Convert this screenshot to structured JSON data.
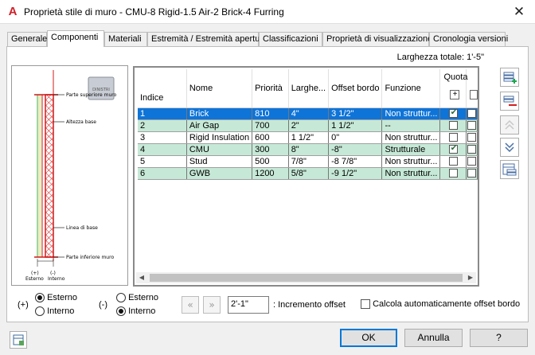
{
  "window": {
    "app_icon": "A",
    "title": "Proprietà stile di muro - CMU-8 Rigid-1.5 Air-2 Brick-4 Furring",
    "close_icon": "close-icon"
  },
  "tabs": [
    {
      "label": "Generale"
    },
    {
      "label": "Componenti"
    },
    {
      "label": "Materiali"
    },
    {
      "label": "Estremità / Estremità apertura"
    },
    {
      "label": "Classificazioni"
    },
    {
      "label": "Proprietà di visualizzazione"
    },
    {
      "label": "Cronologia versioni"
    }
  ],
  "total_width": "Larghezza totale: 1'-5\"",
  "preview": {
    "labels": {
      "top": "Parte superiore muro",
      "height": "Altezza base",
      "baseline": "Linea di base",
      "bottom": "Parte inferiore muro",
      "ext_sign": "(+)",
      "ext": "Esterno",
      "int_sign": "(-)",
      "int": "Interno"
    },
    "stamp": "DINISTRI"
  },
  "grid": {
    "headers": {
      "index": "Indice",
      "name": "Nome",
      "priority": "Priorità",
      "width": "Larghe...",
      "offset": "Offset bordo",
      "function": "Funzione",
      "quota": "Quota"
    },
    "rows": [
      {
        "index": "1",
        "name": "Brick",
        "priority": "810",
        "width": "4\"",
        "offset": "3 1/2\"",
        "function": "Non struttur...",
        "quota": true
      },
      {
        "index": "2",
        "name": "Air Gap",
        "priority": "700",
        "width": "2\"",
        "offset": "1 1/2\"",
        "function": "--",
        "quota": false
      },
      {
        "index": "3",
        "name": "Rigid Insulation",
        "priority": "600",
        "width": "1 1/2\"",
        "offset": "0\"",
        "function": "Non struttur...",
        "quota": false
      },
      {
        "index": "4",
        "name": "CMU",
        "priority": "300",
        "width": "8\"",
        "offset": "-8\"",
        "function": "Strutturale",
        "quota": true
      },
      {
        "index": "5",
        "name": "Stud",
        "priority": "500",
        "width": "7/8\"",
        "offset": "-8 7/8\"",
        "function": "Non struttur...",
        "quota": false
      },
      {
        "index": "6",
        "name": "GWB",
        "priority": "1200",
        "width": "5/8\"",
        "offset": "-9 1/2\"",
        "function": "Non struttur...",
        "quota": false
      }
    ]
  },
  "side_buttons": [
    {
      "name": "add-component-button",
      "icon": "add-row-icon",
      "enabled": true
    },
    {
      "name": "remove-component-button",
      "icon": "remove-row-icon",
      "enabled": true
    },
    {
      "name": "move-up-button",
      "icon": "chevron-up-icon",
      "enabled": false
    },
    {
      "name": "move-down-button",
      "icon": "chevron-down-icon",
      "enabled": true
    },
    {
      "name": "copy-component-button",
      "icon": "copy-row-icon",
      "enabled": true
    }
  ],
  "bottom": {
    "plus_sign": "(+)",
    "plus_ext": "Esterno",
    "plus_int": "Interno",
    "minus_sign": "(-)",
    "minus_ext": "Esterno",
    "minus_int": "Interno",
    "increment_value": "2'-1\"",
    "increment_label": ": Incremento offset",
    "auto_calc_label": "Calcola automaticamente offset bordo"
  },
  "footer": {
    "ok": "OK",
    "cancel": "Annulla",
    "help": "?"
  },
  "colors": {
    "selected_row": "#0e74d8",
    "alt_row": "#c6e9d7",
    "accent": "#0078d7",
    "app_red": "#d0202a"
  }
}
